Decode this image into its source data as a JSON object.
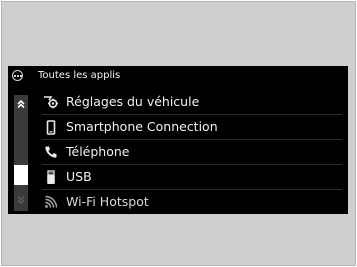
{
  "screen": {
    "header": {
      "icon": "apps-grid-icon",
      "title": "Toutes les applis"
    },
    "scrollbar": {
      "up_icon": "double-chevron-up-icon",
      "down_icon": "double-chevron-down-icon"
    },
    "items": [
      {
        "icon": "vehicle-settings-icon",
        "label": "Réglages du véhicule"
      },
      {
        "icon": "smartphone-icon",
        "label": "Smartphone Connection"
      },
      {
        "icon": "phone-icon",
        "label": "Téléphone"
      },
      {
        "icon": "usb-icon",
        "label": "USB"
      },
      {
        "icon": "wifi-hotspot-icon",
        "label": "Wi-Fi Hotspot"
      }
    ],
    "colors": {
      "background": "#000000",
      "text": "#f2f2f2",
      "frame": "#cfcfcf"
    }
  }
}
